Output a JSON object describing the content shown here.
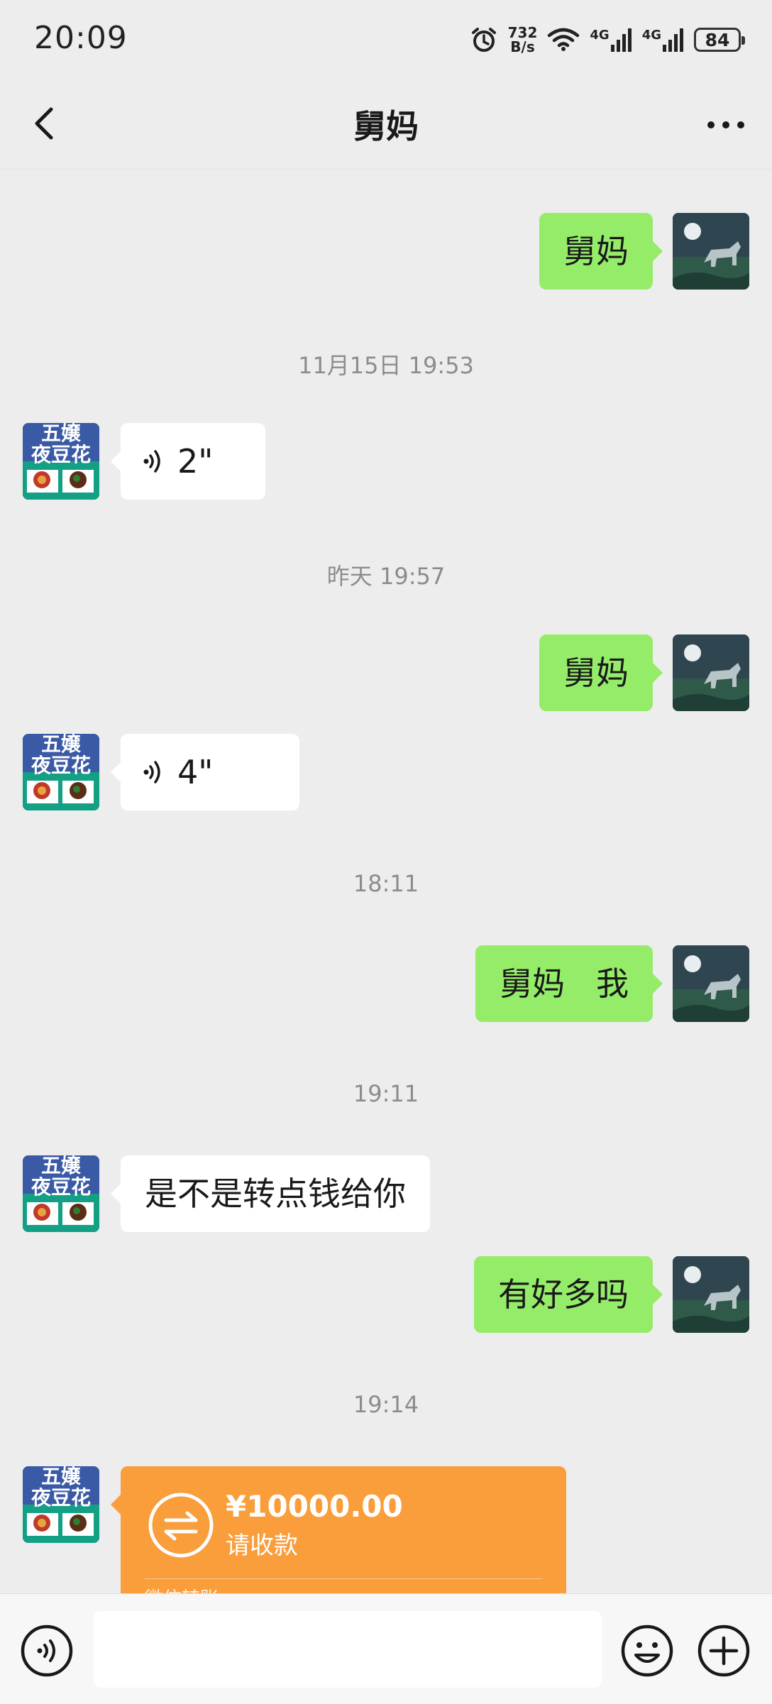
{
  "status_bar": {
    "time": "20:09",
    "net_speed_value": "732",
    "net_speed_unit": "B/s",
    "signal1": "4G",
    "signal2": "4G",
    "battery": "84",
    "icons": [
      "alarm-icon",
      "wifi-icon",
      "cellular-signal-icon",
      "cellular-signal-icon",
      "battery-icon"
    ]
  },
  "header": {
    "title": "舅妈",
    "back_icon": "chevron-left-icon",
    "more_icon": "more-dots-icon"
  },
  "messages": [
    {
      "type": "text",
      "direction": "out",
      "text": "舅妈"
    },
    {
      "type": "timestamp",
      "text": "11月15日 19:53"
    },
    {
      "type": "voice",
      "direction": "in",
      "duration": "2\""
    },
    {
      "type": "timestamp",
      "text": "昨天 19:57"
    },
    {
      "type": "text",
      "direction": "out",
      "text": "舅妈"
    },
    {
      "type": "voice",
      "direction": "in",
      "duration": "4\""
    },
    {
      "type": "timestamp",
      "text": "18:11"
    },
    {
      "type": "text",
      "direction": "out",
      "text": "舅妈   我"
    },
    {
      "type": "timestamp",
      "text": "19:11"
    },
    {
      "type": "text",
      "direction": "in",
      "text": "是不是转点钱给你"
    },
    {
      "type": "text",
      "direction": "out",
      "text": "有好多吗"
    },
    {
      "type": "timestamp",
      "text": "19:14"
    },
    {
      "type": "transfer",
      "direction": "in",
      "amount": "¥10000.00",
      "label": "请收款",
      "footer": "微信转账"
    }
  ],
  "contact_avatar": {
    "line1": "五嬢",
    "line2": "夜豆花",
    "colors": {
      "top": "#3a5aa6",
      "bottom": "#14a085",
      "title": "#ffffff"
    }
  },
  "input_bar": {
    "voice_icon": "voice-input-icon",
    "emoji_icon": "emoji-icon",
    "plus_icon": "plus-icon",
    "placeholder": ""
  },
  "colors": {
    "background": "#ededed",
    "outgoing_bubble": "#95ec69",
    "incoming_bubble": "#ffffff",
    "transfer": "#fa9d3b",
    "timestamp": "#8c8c8c"
  }
}
